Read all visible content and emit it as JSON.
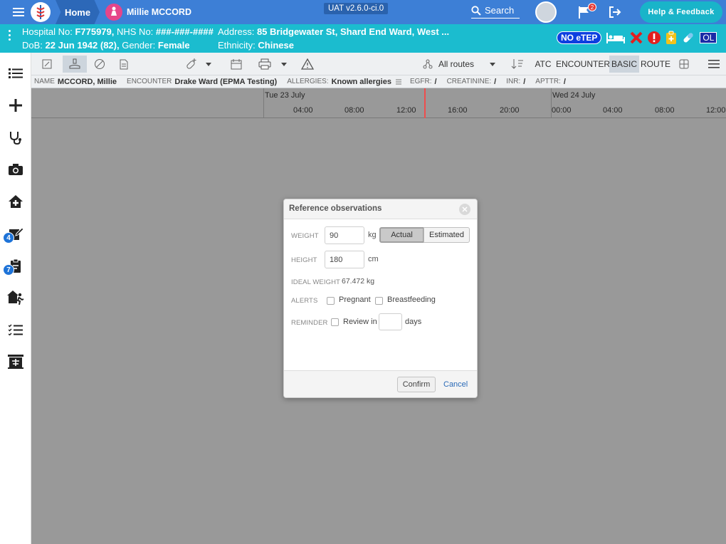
{
  "topbar": {
    "home_label": "Home",
    "patient_name": "Millie MCCORD",
    "version": "UAT v2.6.0-ci.0",
    "search_label": "Search",
    "flag_count": "2",
    "help_label": "Help & Feedback"
  },
  "banner": {
    "hospital_no_label": "Hospital No:",
    "hospital_no": "F775979,",
    "nhs_no_label": "NHS No:",
    "nhs_no": "###-###-####",
    "address_label": "Address:",
    "address": "85 Bridgewater St, Shard End Ward, West ...",
    "dob_label": "DoB:",
    "dob": "22 Jun 1942 (82),",
    "gender_label": "Gender:",
    "gender": "Female",
    "ethnicity_label": "Ethnicity:",
    "ethnicity": "Chinese",
    "no_etep_label": "NO eTEP",
    "ol_label": "OL"
  },
  "sidebar": {
    "badges": [
      "4",
      "7"
    ]
  },
  "toolbar": {
    "routes_label": "All routes",
    "atc_label": "ATC",
    "encounter_label": "ENCOUNTER",
    "basic_label": "BASIC",
    "route_label": "ROUTE"
  },
  "info": {
    "name_label": "NAME",
    "name": "MCCORD, Millie",
    "encounter_label": "ENCOUNTER",
    "encounter": "Drake Ward (EPMA Testing)",
    "allergies_label": "ALLERGIES:",
    "allergies": "Known allergies",
    "egfr_label": "EGFR:",
    "egfr": "/",
    "creatinine_label": "CREATININE:",
    "creatinine": "/",
    "inr_label": "INR:",
    "inr": "/",
    "apttr_label": "APTTR:",
    "apttr": "/"
  },
  "timeline": {
    "day1": "Tue 23 July",
    "day2": "Wed 24 July",
    "hours": [
      "04:00",
      "08:00",
      "12:00",
      "16:00",
      "20:00",
      "00:00",
      "04:00",
      "08:00",
      "12:00"
    ]
  },
  "dialog": {
    "title": "Reference observations",
    "weight_label": "WEIGHT",
    "weight_value": "90",
    "weight_unit": "kg",
    "actual_label": "Actual",
    "estimated_label": "Estimated",
    "height_label": "HEIGHT",
    "height_value": "180",
    "height_unit": "cm",
    "ideal_weight_label": "IDEAL WEIGHT",
    "ideal_weight_value": "67.472 kg",
    "alerts_label": "ALERTS",
    "pregnant_label": "Pregnant",
    "breastfeeding_label": "Breastfeeding",
    "reminder_label": "REMINDER",
    "review_in_label": "Review in",
    "days_label": "days",
    "confirm_label": "Confirm",
    "cancel_label": "Cancel"
  },
  "colors": {
    "topbar": "#3d7fd6",
    "banner": "#1bbccf",
    "now_line": "#ef4d4d",
    "link": "#2a6ab7"
  }
}
